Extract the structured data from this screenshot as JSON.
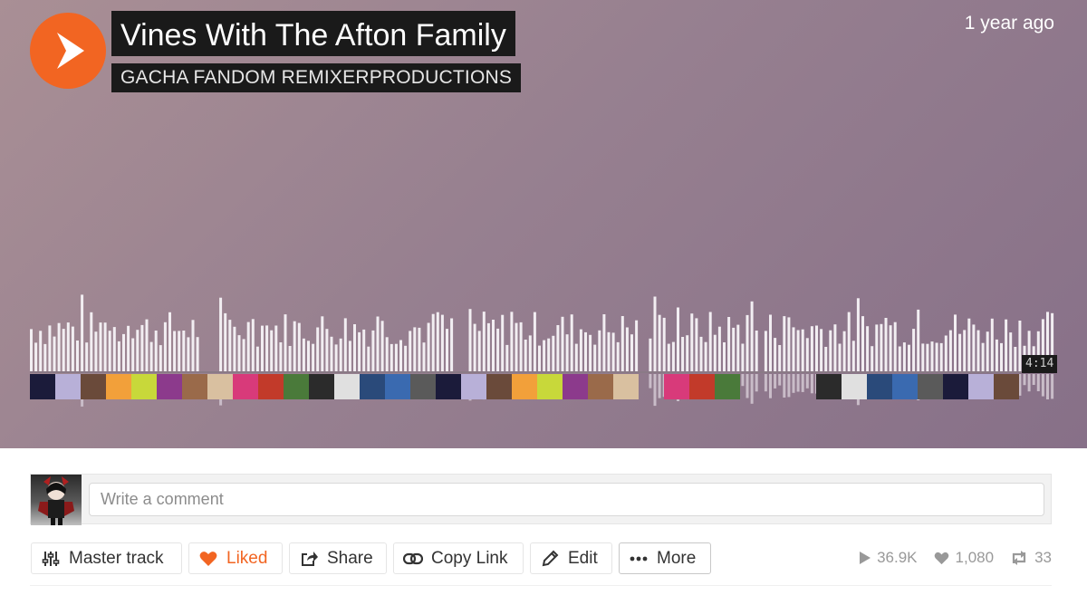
{
  "track": {
    "title": "Vines With The Afton Family",
    "artist": "GACHA FANDOM REMIXERPRODUCTIONS",
    "posted": "1 year ago",
    "duration": "4:14"
  },
  "comment": {
    "placeholder": "Write a comment"
  },
  "actions": {
    "master_track": "Master track",
    "liked": "Liked",
    "share": "Share",
    "copy_link": "Copy Link",
    "edit": "Edit",
    "more": "More"
  },
  "stats": {
    "plays": "36.9K",
    "likes": "1,080",
    "reposts": "33"
  },
  "colors": {
    "accent": "#f26522",
    "hero_bg": "#978090",
    "waveform_bar": "#f2eef2",
    "stat_gray": "#999999"
  },
  "icons": [
    "play-icon",
    "sliders-icon",
    "heart-icon",
    "share-icon",
    "link-icon",
    "pencil-icon",
    "ellipsis-icon",
    "plays-icon",
    "likes-icon",
    "repost-icon"
  ]
}
